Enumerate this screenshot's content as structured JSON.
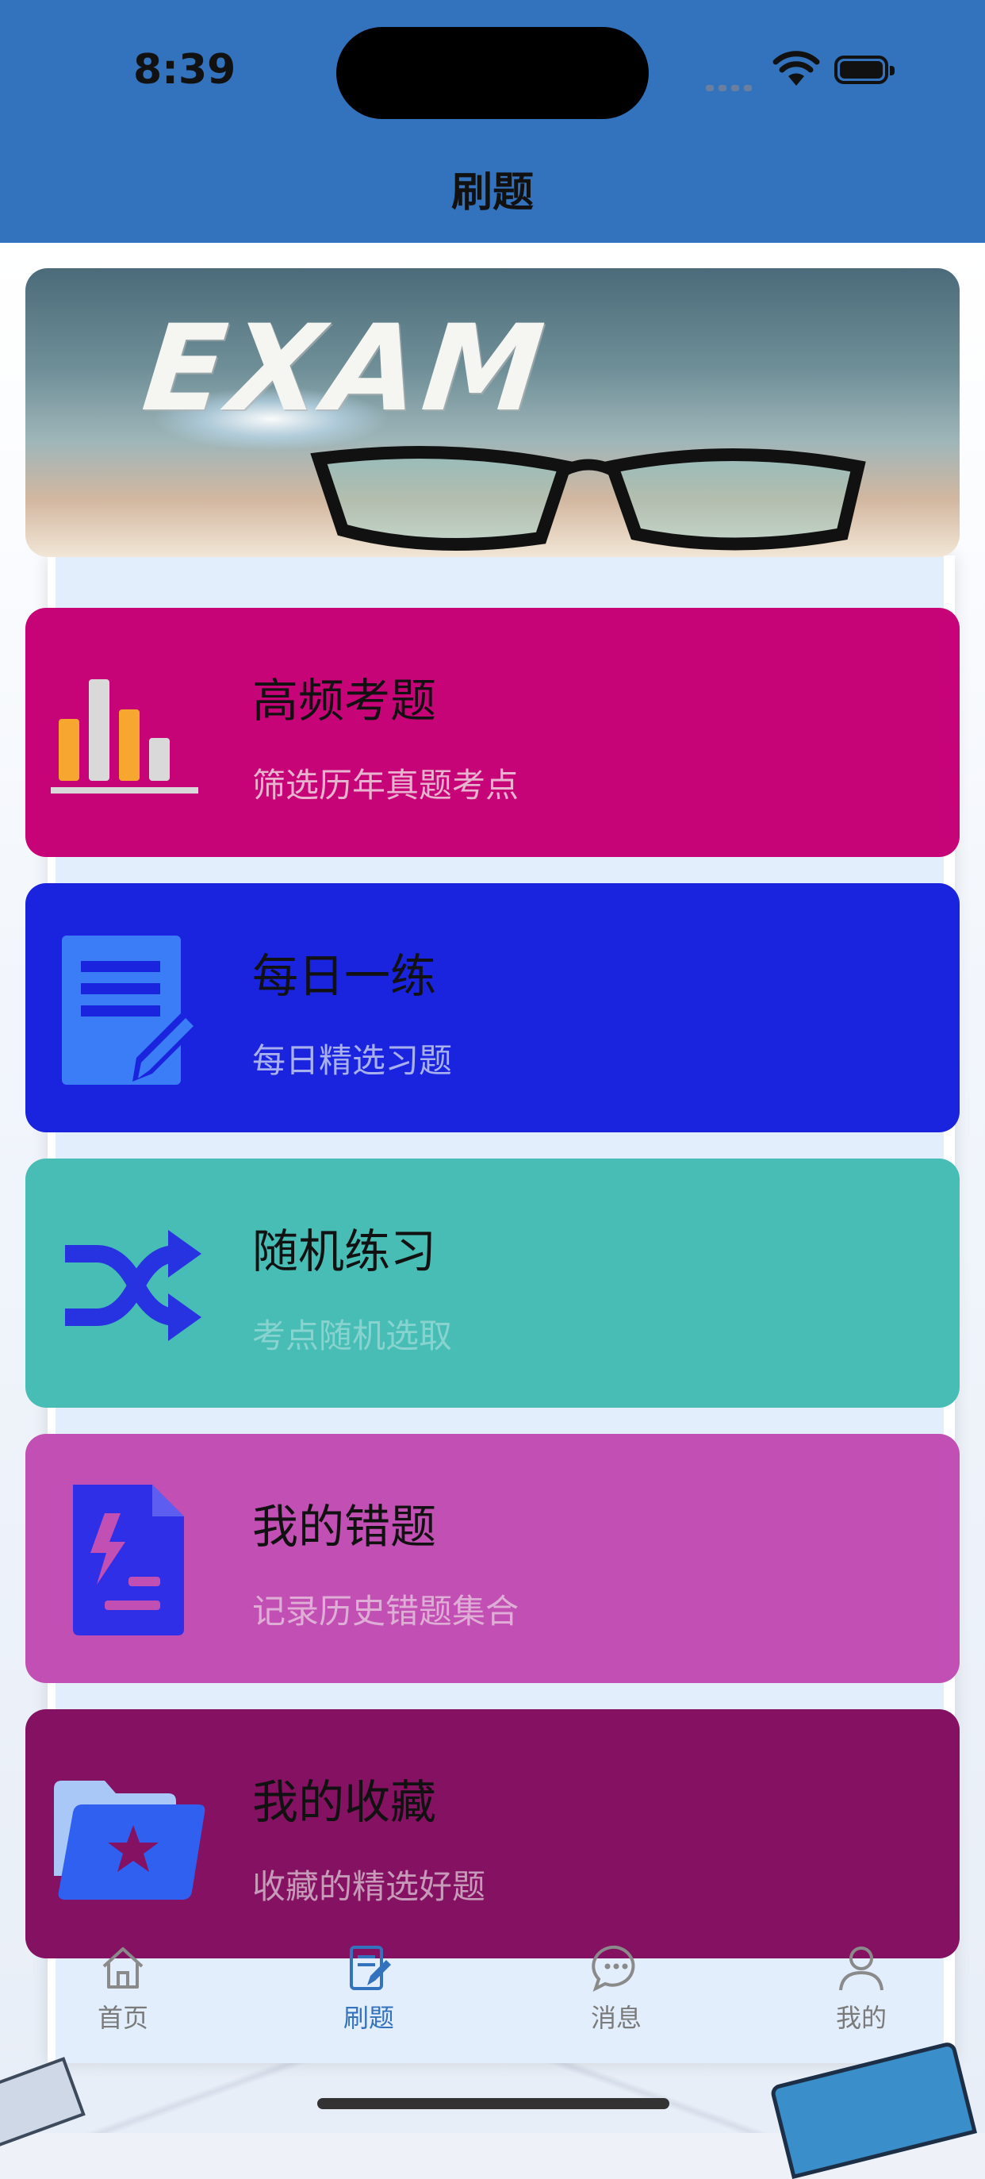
{
  "status_bar": {
    "time": "8:39"
  },
  "header": {
    "title": "刷题"
  },
  "banner": {
    "word": "EXAM"
  },
  "cards": [
    {
      "title": "高频考题",
      "subtitle": "筛选历年真题考点",
      "bg": "#c70477",
      "sub_color": "#e8b3cf",
      "icon": "bar-chart-icon"
    },
    {
      "title": "每日一练",
      "subtitle": "每日精选习题",
      "bg": "#1a24de",
      "sub_color": "#a9b0ee",
      "icon": "document-edit-icon"
    },
    {
      "title": "随机练习",
      "subtitle": "考点随机选取",
      "bg": "#47bdb5",
      "sub_color": "#88d3cf",
      "icon": "shuffle-icon"
    },
    {
      "title": "我的错题",
      "subtitle": "记录历史错题集合",
      "bg": "#c24fb3",
      "sub_color": "#dfaed6",
      "icon": "error-file-icon"
    },
    {
      "title": "我的收藏",
      "subtitle": "收藏的精选好题",
      "bg": "#841161",
      "sub_color": "#c69ab8",
      "icon": "star-folder-icon"
    }
  ],
  "tabbar": {
    "items": [
      {
        "label": "首页",
        "icon": "home-icon",
        "active": false
      },
      {
        "label": "刷题",
        "icon": "practice-icon",
        "active": true
      },
      {
        "label": "消息",
        "icon": "message-icon",
        "active": false
      },
      {
        "label": "我的",
        "icon": "profile-icon",
        "active": false
      }
    ]
  },
  "colors": {
    "header": "#3372bd",
    "active_tab": "#3372bd",
    "inactive_tab": "#7a7a7a"
  }
}
